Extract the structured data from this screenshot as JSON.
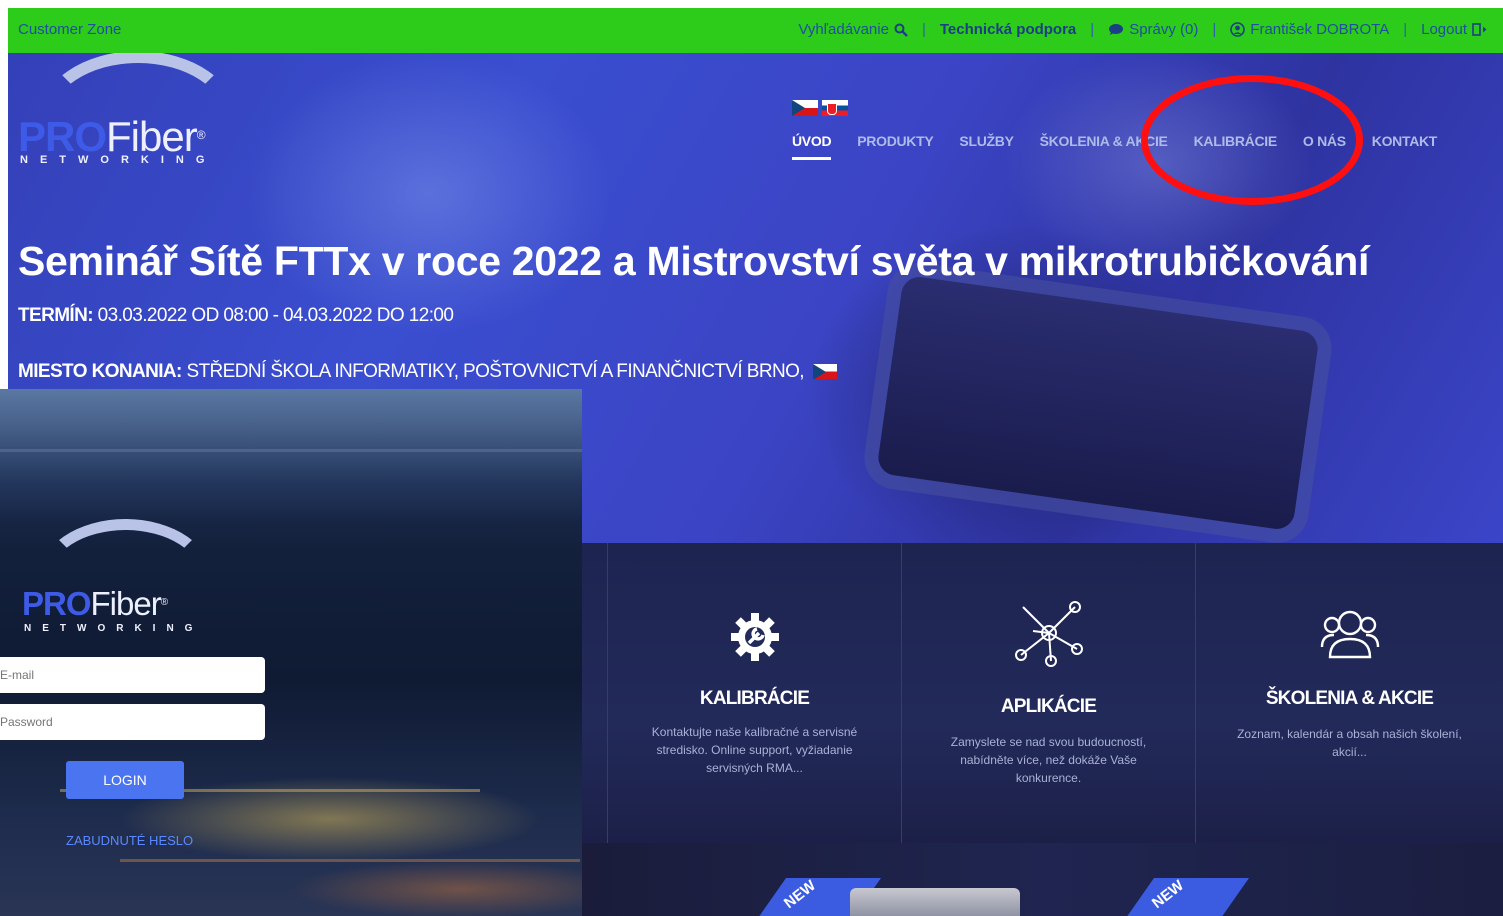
{
  "topbar": {
    "zone_label": "Customer Zone",
    "search_label": "Vyhľadávanie",
    "support_label": "Technická podpora",
    "messages_label": "Správy (0)",
    "user_label": "František DOBROTA",
    "logout_label": "Logout",
    "separator": "|"
  },
  "logo": {
    "pro": "PRO",
    "fiber": "Fiber",
    "reg": "®",
    "networking": "NETWORKING"
  },
  "nav": {
    "items": [
      "ÚVOD",
      "PRODUKTY",
      "SLUŽBY",
      "ŠKOLENIA & AKCIE",
      "KALIBRÁCIE",
      "O NÁS",
      "KONTAKT"
    ]
  },
  "hero": {
    "title": "Seminář Sítě FTTx v roce 2022 a Mistrovství světa v mikrotrubičkování",
    "date_label": "TERMÍN:",
    "date_value": "03.03.2022 OD 08:00 - 04.03.2022 DO 12:00",
    "venue_label": "MIESTO KONANIA:",
    "venue_value": "STŘEDNÍ ŠKOLA INFORMATIKY, POŠTOVNICTVÍ A FINANČNICTVÍ BRNO,"
  },
  "features": [
    {
      "title": "KALIBRÁCIE",
      "desc": "Kontaktujte naše kalibračné a servisné stredisko. Online support, vyžiadanie servisných RMA..."
    },
    {
      "title": "APLIKÁCIE",
      "desc": "Zamyslete se nad svou budoucností, nabídněte více, než dokáže Vaše konkurence."
    },
    {
      "title": "ŠKOLENIA & AKCIE",
      "desc": "Zoznam, kalendár a obsah našich školení, akcií..."
    }
  ],
  "badges": [
    "NEW",
    "NEW"
  ],
  "login": {
    "email_placeholder": "E-mail",
    "password_placeholder": "Password",
    "login_label": "LOGIN",
    "forgot_label": "ZABUDNUTÉ HESLO"
  },
  "colors": {
    "topbar": "#2ecc1a",
    "accent": "#4a74f0",
    "highlight_circle": "#ff1010"
  },
  "icons": [
    "search-icon",
    "chat-icon",
    "user-icon",
    "logout-icon",
    "gear-wrench-icon",
    "network-icon",
    "team-icon"
  ]
}
